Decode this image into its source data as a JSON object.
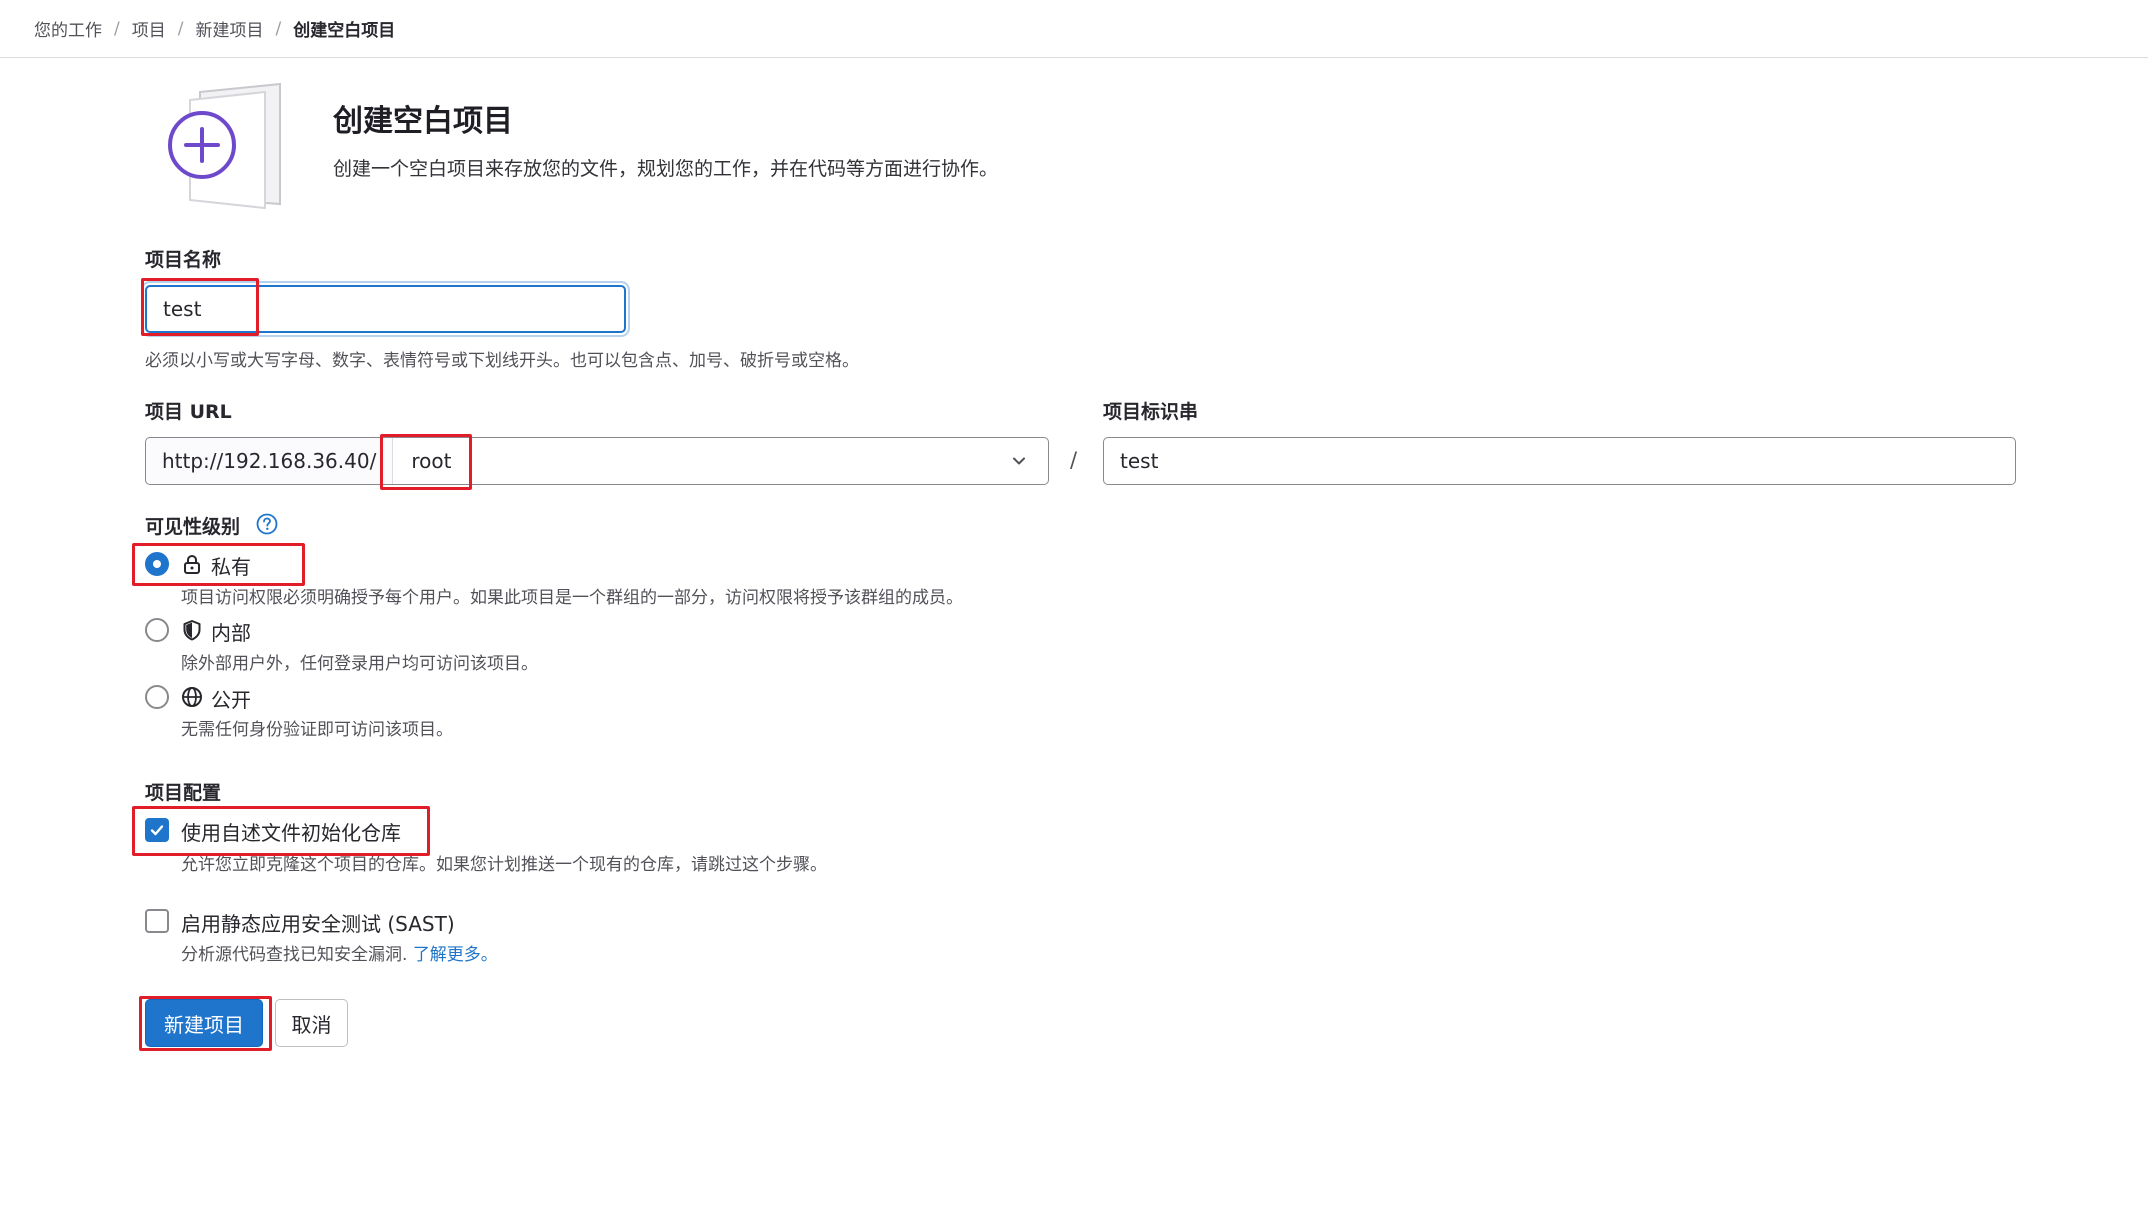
{
  "breadcrumb": [
    "您的工作",
    "项目",
    "新建项目",
    "创建空白项目"
  ],
  "header": {
    "title": "创建空白项目",
    "description": "创建一个空白项目来存放您的文件，规划您的工作，并在代码等方面进行协作。"
  },
  "project_name": {
    "label": "项目名称",
    "value": "test",
    "help": "必须以小写或大写字母、数字、表情符号或下划线开头。也可以包含点、加号、破折号或空格。"
  },
  "project_url": {
    "label": "项目 URL",
    "prefix": "http://192.168.36.40/",
    "namespace": "root",
    "separator": "/"
  },
  "project_slug": {
    "label": "项目标识串",
    "value": "test"
  },
  "visibility": {
    "label": "可见性级别",
    "options": [
      {
        "label": "私有",
        "icon": "lock-icon",
        "checked": true,
        "desc": "项目访问权限必须明确授予每个用户。如果此项目是一个群组的一部分，访问权限将授予该群组的成员。"
      },
      {
        "label": "内部",
        "icon": "shield-icon",
        "checked": false,
        "desc": "除外部用户外，任何登录用户均可访问该项目。"
      },
      {
        "label": "公开",
        "icon": "globe-icon",
        "checked": false,
        "desc": "无需任何身份验证即可访问该项目。"
      }
    ]
  },
  "config": {
    "label": "项目配置",
    "readme": {
      "label": "使用自述文件初始化仓库",
      "checked": true,
      "desc": "允许您立即克隆这个项目的仓库。如果您计划推送一个现有的仓库，请跳过这个步骤。"
    },
    "sast": {
      "label": "启用静态应用安全测试 (SAST)",
      "checked": false,
      "desc": "分析源代码查找已知安全漏洞.",
      "link": "了解更多。"
    }
  },
  "actions": {
    "create": "新建项目",
    "cancel": "取消"
  },
  "colors": {
    "primary": "#1f75cb",
    "annotation": "#e11d2a",
    "illustration": "#6e49cb"
  }
}
